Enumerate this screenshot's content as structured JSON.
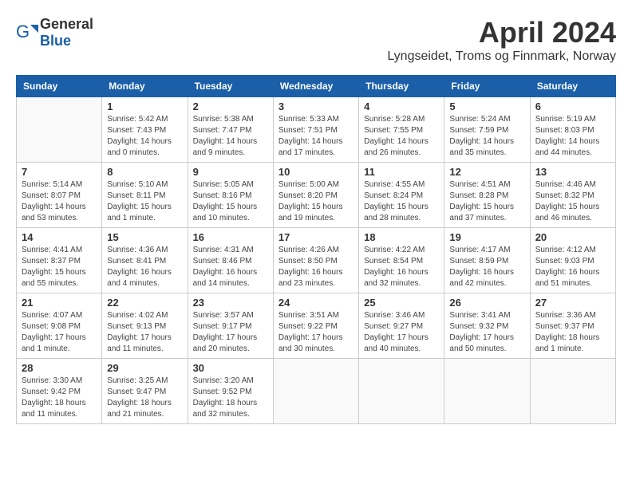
{
  "header": {
    "logo_general": "General",
    "logo_blue": "Blue",
    "month_title": "April 2024",
    "location": "Lyngseidet, Troms og Finnmark, Norway"
  },
  "weekdays": [
    "Sunday",
    "Monday",
    "Tuesday",
    "Wednesday",
    "Thursday",
    "Friday",
    "Saturday"
  ],
  "weeks": [
    [
      {
        "day": "",
        "info": ""
      },
      {
        "day": "1",
        "info": "Sunrise: 5:42 AM\nSunset: 7:43 PM\nDaylight: 14 hours\nand 0 minutes."
      },
      {
        "day": "2",
        "info": "Sunrise: 5:38 AM\nSunset: 7:47 PM\nDaylight: 14 hours\nand 9 minutes."
      },
      {
        "day": "3",
        "info": "Sunrise: 5:33 AM\nSunset: 7:51 PM\nDaylight: 14 hours\nand 17 minutes."
      },
      {
        "day": "4",
        "info": "Sunrise: 5:28 AM\nSunset: 7:55 PM\nDaylight: 14 hours\nand 26 minutes."
      },
      {
        "day": "5",
        "info": "Sunrise: 5:24 AM\nSunset: 7:59 PM\nDaylight: 14 hours\nand 35 minutes."
      },
      {
        "day": "6",
        "info": "Sunrise: 5:19 AM\nSunset: 8:03 PM\nDaylight: 14 hours\nand 44 minutes."
      }
    ],
    [
      {
        "day": "7",
        "info": "Sunrise: 5:14 AM\nSunset: 8:07 PM\nDaylight: 14 hours\nand 53 minutes."
      },
      {
        "day": "8",
        "info": "Sunrise: 5:10 AM\nSunset: 8:11 PM\nDaylight: 15 hours\nand 1 minute."
      },
      {
        "day": "9",
        "info": "Sunrise: 5:05 AM\nSunset: 8:16 PM\nDaylight: 15 hours\nand 10 minutes."
      },
      {
        "day": "10",
        "info": "Sunrise: 5:00 AM\nSunset: 8:20 PM\nDaylight: 15 hours\nand 19 minutes."
      },
      {
        "day": "11",
        "info": "Sunrise: 4:55 AM\nSunset: 8:24 PM\nDaylight: 15 hours\nand 28 minutes."
      },
      {
        "day": "12",
        "info": "Sunrise: 4:51 AM\nSunset: 8:28 PM\nDaylight: 15 hours\nand 37 minutes."
      },
      {
        "day": "13",
        "info": "Sunrise: 4:46 AM\nSunset: 8:32 PM\nDaylight: 15 hours\nand 46 minutes."
      }
    ],
    [
      {
        "day": "14",
        "info": "Sunrise: 4:41 AM\nSunset: 8:37 PM\nDaylight: 15 hours\nand 55 minutes."
      },
      {
        "day": "15",
        "info": "Sunrise: 4:36 AM\nSunset: 8:41 PM\nDaylight: 16 hours\nand 4 minutes."
      },
      {
        "day": "16",
        "info": "Sunrise: 4:31 AM\nSunset: 8:46 PM\nDaylight: 16 hours\nand 14 minutes."
      },
      {
        "day": "17",
        "info": "Sunrise: 4:26 AM\nSunset: 8:50 PM\nDaylight: 16 hours\nand 23 minutes."
      },
      {
        "day": "18",
        "info": "Sunrise: 4:22 AM\nSunset: 8:54 PM\nDaylight: 16 hours\nand 32 minutes."
      },
      {
        "day": "19",
        "info": "Sunrise: 4:17 AM\nSunset: 8:59 PM\nDaylight: 16 hours\nand 42 minutes."
      },
      {
        "day": "20",
        "info": "Sunrise: 4:12 AM\nSunset: 9:03 PM\nDaylight: 16 hours\nand 51 minutes."
      }
    ],
    [
      {
        "day": "21",
        "info": "Sunrise: 4:07 AM\nSunset: 9:08 PM\nDaylight: 17 hours\nand 1 minute."
      },
      {
        "day": "22",
        "info": "Sunrise: 4:02 AM\nSunset: 9:13 PM\nDaylight: 17 hours\nand 11 minutes."
      },
      {
        "day": "23",
        "info": "Sunrise: 3:57 AM\nSunset: 9:17 PM\nDaylight: 17 hours\nand 20 minutes."
      },
      {
        "day": "24",
        "info": "Sunrise: 3:51 AM\nSunset: 9:22 PM\nDaylight: 17 hours\nand 30 minutes."
      },
      {
        "day": "25",
        "info": "Sunrise: 3:46 AM\nSunset: 9:27 PM\nDaylight: 17 hours\nand 40 minutes."
      },
      {
        "day": "26",
        "info": "Sunrise: 3:41 AM\nSunset: 9:32 PM\nDaylight: 17 hours\nand 50 minutes."
      },
      {
        "day": "27",
        "info": "Sunrise: 3:36 AM\nSunset: 9:37 PM\nDaylight: 18 hours\nand 1 minute."
      }
    ],
    [
      {
        "day": "28",
        "info": "Sunrise: 3:30 AM\nSunset: 9:42 PM\nDaylight: 18 hours\nand 11 minutes."
      },
      {
        "day": "29",
        "info": "Sunrise: 3:25 AM\nSunset: 9:47 PM\nDaylight: 18 hours\nand 21 minutes."
      },
      {
        "day": "30",
        "info": "Sunrise: 3:20 AM\nSunset: 9:52 PM\nDaylight: 18 hours\nand 32 minutes."
      },
      {
        "day": "",
        "info": ""
      },
      {
        "day": "",
        "info": ""
      },
      {
        "day": "",
        "info": ""
      },
      {
        "day": "",
        "info": ""
      }
    ]
  ]
}
